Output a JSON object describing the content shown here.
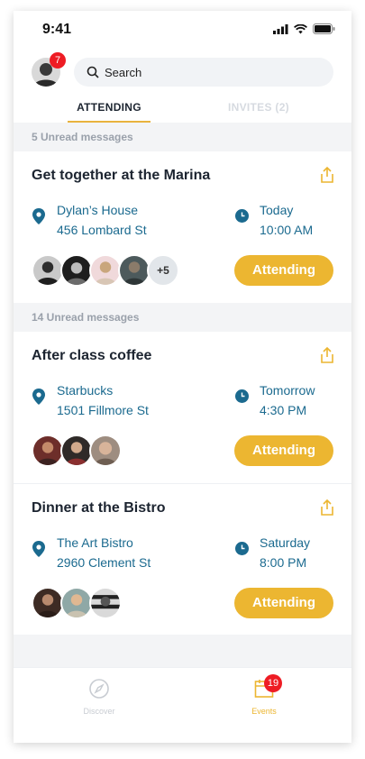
{
  "status_bar": {
    "time": "9:41"
  },
  "header": {
    "avatar_badge": "7",
    "search": {
      "placeholder": "Search"
    }
  },
  "tabs": [
    {
      "label": "ATTENDING",
      "active": true
    },
    {
      "label": "INVITES (2)",
      "active": false
    }
  ],
  "events": [
    {
      "section": "5 Unread messages",
      "title": "Get together at the Marina",
      "location_name": "Dylan’s House",
      "location_address": "456 Lombard St",
      "day": "Today",
      "time": "10:00 AM",
      "attendees_more": "+5",
      "button": "Attending"
    },
    {
      "section": "14 Unread messages",
      "title": "After class coffee",
      "location_name": "Starbucks",
      "location_address": "1501 Fillmore St",
      "day": "Tomorrow",
      "time": "4:30 PM",
      "button": "Attending"
    },
    {
      "title": "Dinner at the Bistro",
      "location_name": "The Art Bistro",
      "location_address": "2960 Clement St",
      "day": "Saturday",
      "time": "8:00 PM",
      "button": "Attending"
    }
  ],
  "nav": {
    "discover": "Discover",
    "events": "Events",
    "events_badge": "19"
  },
  "colors": {
    "accent": "#ecb631",
    "link": "#1b6a8f",
    "badge": "#ee1c24"
  }
}
